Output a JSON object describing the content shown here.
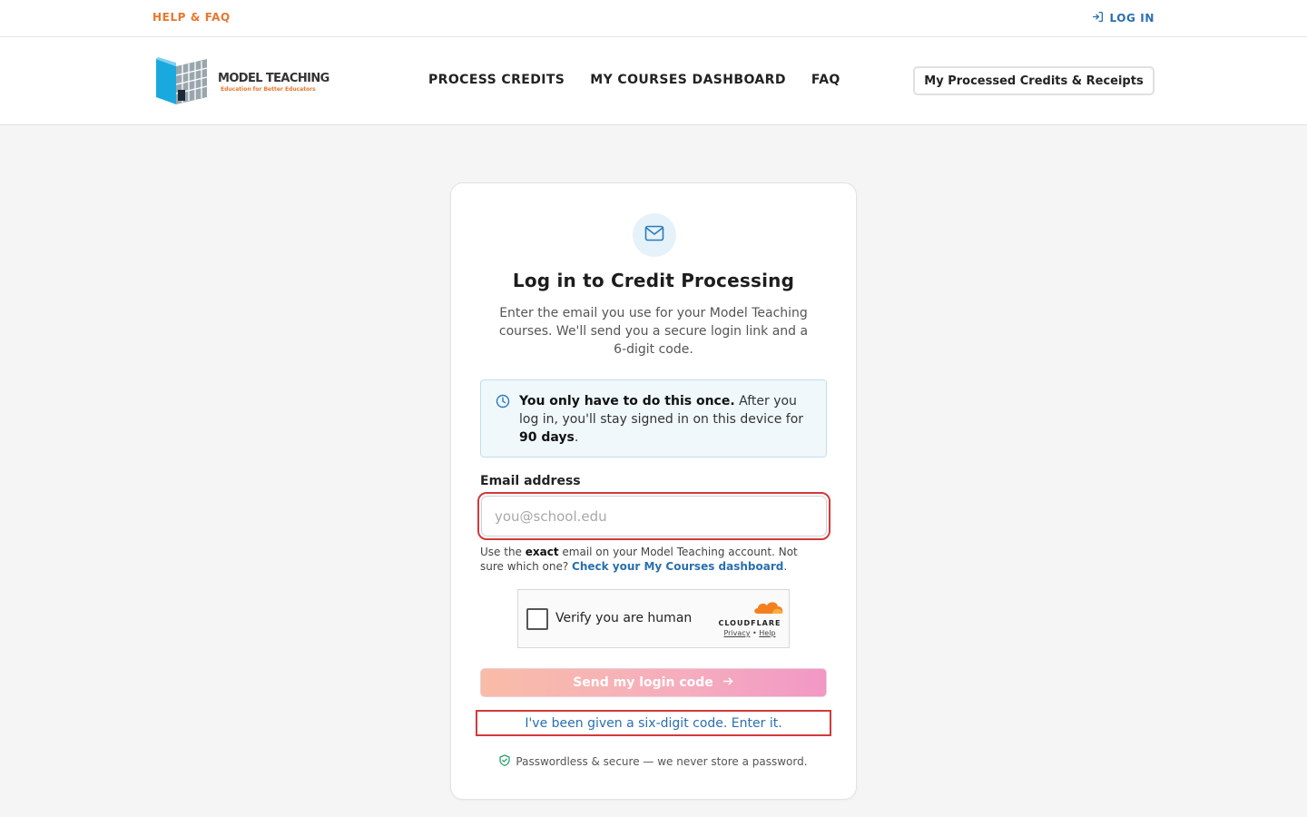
{
  "topbar": {
    "help_label": "HELP & FAQ",
    "login_label": "LOG IN"
  },
  "brand": {
    "name": "MODEL TEACHING",
    "tagline": "Education for Better Educators"
  },
  "nav": {
    "items": [
      {
        "label": "PROCESS CREDITS"
      },
      {
        "label": "MY COURSES DASHBOARD"
      },
      {
        "label": "FAQ"
      }
    ],
    "receipts_button": "My Processed Credits & Receipts"
  },
  "login_card": {
    "icon": "mail-icon",
    "title": "Log in to Credit Processing",
    "description": "Enter the email you use for your Model Teaching courses. We'll send you a secure login link and a 6-digit code.",
    "info": {
      "icon": "clock-icon",
      "bold_intro": "You only have to do this once.",
      "text_middle": " After you log in, you'll stay signed in on this device for ",
      "bold_days": "90 days",
      "text_end": "."
    },
    "email": {
      "label": "Email address",
      "placeholder": "you@school.edu",
      "value": "",
      "hint_prefix": "Use the ",
      "hint_bold": "exact",
      "hint_middle": " email on your Model Teaching account. Not sure which one? ",
      "hint_link": "Check your My Courses dashboard",
      "hint_end": "."
    },
    "captcha": {
      "label": "Verify you are human",
      "brand": "CLOUDFLARE",
      "privacy": "Privacy",
      "separator": "•",
      "help": "Help"
    },
    "send_button": "Send my login code",
    "code_link": "I've been given a six-digit code. Enter it.",
    "secure_note": "Passwordless & secure — we never store a password."
  },
  "colors": {
    "accent_orange": "#e8762c",
    "link_blue": "#2a6fb0",
    "highlight_red": "#d23a3a",
    "button_gradient_start": "#f8b198",
    "button_gradient_end": "#ef86bc"
  }
}
